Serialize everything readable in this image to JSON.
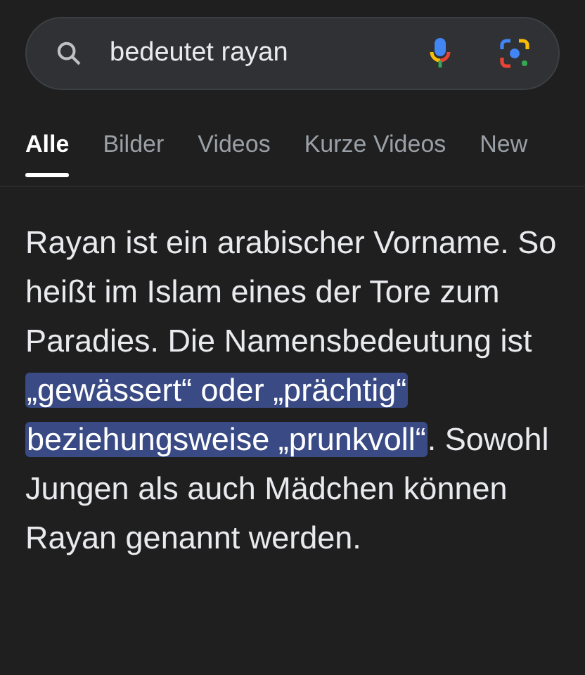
{
  "search": {
    "value": "bedeutet rayan"
  },
  "tabs": [
    {
      "label": "Alle",
      "selected": true
    },
    {
      "label": "Bilder",
      "selected": false
    },
    {
      "label": "Videos",
      "selected": false
    },
    {
      "label": "Kurze Videos",
      "selected": false
    },
    {
      "label": "New",
      "selected": false
    }
  ],
  "answer": [
    {
      "text": "Rayan ist ein arabischer Vorname. So heißt im Islam eines der Tore zum Paradies. Die Namensbedeutung ist ",
      "highlighted": false
    },
    {
      "text": "„gewässert“ oder „prächtig“ beziehungsweise „prunkvoll“",
      "highlighted": true
    },
    {
      "text": ". Sowohl Jungen als auch Mädchen können Rayan genannt werden.",
      "highlighted": false
    }
  ]
}
